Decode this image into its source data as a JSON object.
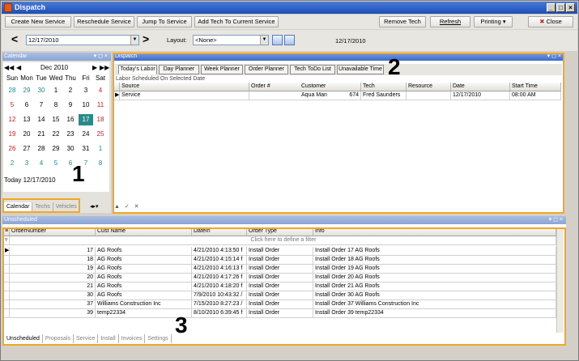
{
  "window": {
    "title": "Dispatch",
    "controls": [
      "_",
      "□",
      "×"
    ]
  },
  "toolbar": {
    "create": "Create New Service",
    "reschedule": "Reschedule Service",
    "jump": "Jump To Service",
    "addtech": "Add Tech To Current Service",
    "remove": "Remove Tech",
    "refresh": "Refresh",
    "printing": "Printing",
    "close": "Close"
  },
  "nav": {
    "date": "12/17/2010",
    "layout_label": "Layout:",
    "layout_value": "<None>",
    "date_right": "12/17/2010"
  },
  "calendar_panel": {
    "title": "Calendar",
    "month": "Dec 2010",
    "dow": [
      "Sun",
      "Mon",
      "Tue",
      "Wed",
      "Thu",
      "Fri",
      "Sat"
    ],
    "weeks": [
      [
        "28",
        "29",
        "30",
        "1",
        "2",
        "3",
        "4"
      ],
      [
        "5",
        "6",
        "7",
        "8",
        "9",
        "10",
        "11"
      ],
      [
        "12",
        "13",
        "14",
        "15",
        "16",
        "17",
        "18"
      ],
      [
        "19",
        "20",
        "21",
        "22",
        "23",
        "24",
        "25"
      ],
      [
        "26",
        "27",
        "28",
        "29",
        "30",
        "31",
        "1"
      ],
      [
        "2",
        "3",
        "4",
        "5",
        "6",
        "7",
        "8"
      ]
    ],
    "today": "Today 12/17/2010",
    "tabs": [
      "Calendar",
      "Techs",
      "Vehicles"
    ]
  },
  "callouts": {
    "one": "1",
    "two": "2",
    "three": "3"
  },
  "dispatch_panel": {
    "title": "Dispatch",
    "tabs": [
      "Today's Labor",
      "Day Planner",
      "Week Planner",
      "Order Planner",
      "Tech ToDo List",
      "Unavailable Time"
    ],
    "caption": "Labor Scheduled On Selected Date",
    "columns": [
      "Source",
      "Order #",
      "Customer",
      "Tech",
      "Resource",
      "Date",
      "Start Time"
    ],
    "rows": [
      [
        "Service",
        "674",
        "Aqua Man",
        "Fred Saunders",
        "",
        "12/17/2010",
        "08:00 AM"
      ]
    ]
  },
  "unscheduled_panel": {
    "title": "Unscheduled",
    "columns": [
      "OrderNumber",
      "Cust Name",
      "DateIn",
      "Order Type",
      "Info"
    ],
    "filter_hint": "Click here to define a filter",
    "rows": [
      [
        "17",
        "AG Roofs",
        "4/21/2010 4:13:50 f",
        "Install Order",
        "Install Order 17 AG Roofs"
      ],
      [
        "18",
        "AG Roofs",
        "4/21/2010 4:15:14 f",
        "Install Order",
        "Install Order 18 AG Roofs"
      ],
      [
        "19",
        "AG Roofs",
        "4/21/2010 4:16:13 f",
        "Install Order",
        "Install Order 19 AG Roofs"
      ],
      [
        "20",
        "AG Roofs",
        "4/21/2010 4:17:26 f",
        "Install Order",
        "Install Order 20 AG Roofs"
      ],
      [
        "21",
        "AG Roofs",
        "4/21/2010 4:18:20 f",
        "Install Order",
        "Install Order 21 AG Roofs"
      ],
      [
        "30",
        "AG Roofs",
        "7/9/2010 10:43:32 /",
        "Install Order",
        "Install Order 30 AG Roofs"
      ],
      [
        "37",
        "Williams Construction Inc",
        "7/15/2010 8:27:23 /",
        "Install Order",
        "Install Order 37 Williams Construction Inc"
      ],
      [
        "39",
        "temp22334",
        "8/10/2010 6:39:45 f",
        "Install Order",
        "Install Order 39 temp22334"
      ]
    ],
    "tabs": [
      "Unscheduled",
      "Proposals",
      "Service",
      "Install",
      "Invoices",
      "Settings"
    ]
  }
}
